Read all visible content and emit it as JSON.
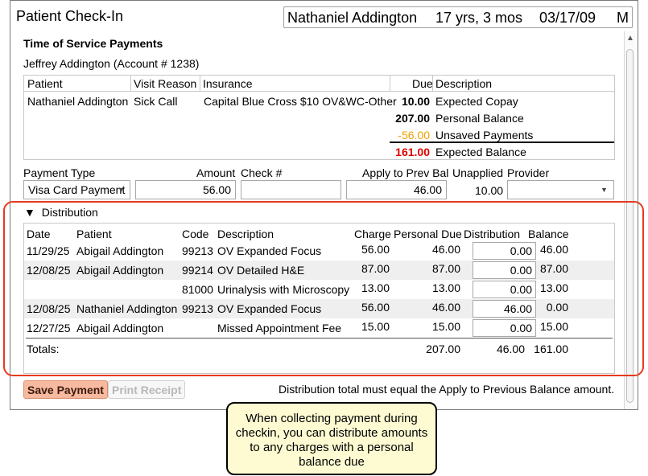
{
  "window": {
    "title": "Patient Check-In"
  },
  "patient_header": {
    "name": "Nathaniel Addington",
    "age": "17 yrs, 3 mos",
    "dob": "03/17/09",
    "sex": "M"
  },
  "section": {
    "title": "Time of Service Payments",
    "account": "Jeffrey Addington (Account # 1238)"
  },
  "visit_table": {
    "headers": {
      "patient": "Patient",
      "visit_reason": "Visit Reason",
      "insurance": "Insurance",
      "due": "Due",
      "description": "Description"
    },
    "row": {
      "patient": "Nathaniel Addington",
      "visit_reason": "Sick Call",
      "insurance": "Capital Blue Cross $10 OV&WC-Other"
    },
    "amounts": [
      {
        "due": "10.00",
        "description": "Expected Copay",
        "color": "#000000"
      },
      {
        "due": "207.00",
        "description": "Personal Balance",
        "color": "#000000"
      },
      {
        "due": "-56.00",
        "description": "Unsaved Payments",
        "color": "#f0a000"
      },
      {
        "due": "161.00",
        "description": "Expected Balance",
        "color": "#e00000"
      }
    ]
  },
  "payment": {
    "labels": {
      "type": "Payment Type",
      "amount": "Amount",
      "check": "Check #",
      "apply": "Apply to Prev Bal",
      "unapplied": "Unapplied",
      "provider": "Provider"
    },
    "type_value": "Visa Card Payment",
    "amount_value": "56.00",
    "check_value": "",
    "apply_value": "46.00",
    "unapplied_value": "10.00",
    "provider_value": ""
  },
  "distribution": {
    "toggle_icon": "triangle-down-icon",
    "label": "Distribution",
    "headers": {
      "date": "Date",
      "patient": "Patient",
      "code": "Code",
      "description": "Description",
      "charge": "Charge",
      "personal_due": "Personal Due",
      "distribution": "Distribution",
      "balance": "Balance"
    },
    "rows": [
      {
        "date": "11/29/25",
        "patient": "Abigail Addington",
        "code": "99213",
        "description": "OV Expanded Focus",
        "charge": "56.00",
        "personal_due": "46.00",
        "distribution": "0.00",
        "balance": "46.00"
      },
      {
        "date": "12/08/25",
        "patient": "Abigail Addington",
        "code": "99214",
        "description": "OV Detailed H&E",
        "charge": "87.00",
        "personal_due": "87.00",
        "distribution": "0.00",
        "balance": "87.00"
      },
      {
        "date": "",
        "patient": "",
        "code": "81000",
        "description": "Urinalysis with Microscopy",
        "charge": "13.00",
        "personal_due": "13.00",
        "distribution": "0.00",
        "balance": "13.00"
      },
      {
        "date": "12/08/25",
        "patient": "Nathaniel Addington",
        "code": "99213",
        "description": "OV Expanded Focus",
        "charge": "56.00",
        "personal_due": "46.00",
        "distribution": "46.00",
        "balance": "0.00"
      },
      {
        "date": "12/27/25",
        "patient": "Abigail Addington",
        "code": "",
        "description": "Missed Appointment Fee",
        "charge": "15.00",
        "personal_due": "15.00",
        "distribution": "0.00",
        "balance": "15.00"
      }
    ],
    "totals": {
      "label": "Totals:",
      "personal_due": "207.00",
      "distribution": "46.00",
      "balance": "161.00"
    }
  },
  "buttons": {
    "save": "Save Payment",
    "print": "Print Receipt"
  },
  "note": "Distribution total must equal the Apply to Previous Balance amount.",
  "callout": "When collecting payment during checkin, you can distribute amounts to any charges with a personal balance due",
  "colors": {
    "highlight": "#e53a1f",
    "save_button": "#f7b9a0",
    "callout_bg": "#fefbd3"
  }
}
